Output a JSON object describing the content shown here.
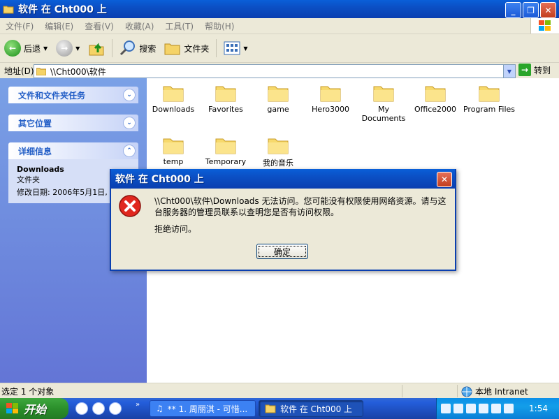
{
  "window": {
    "title": "软件 在 Cht000 上"
  },
  "menu": [
    "文件(F)",
    "编辑(E)",
    "查看(V)",
    "收藏(A)",
    "工具(T)",
    "帮助(H)"
  ],
  "toolbar": {
    "back_label": "后退",
    "search_label": "搜索",
    "folders_label": "文件夹"
  },
  "address": {
    "label": "地址(D)",
    "path": "\\\\Cht000\\软件",
    "go_label": "转到"
  },
  "taskpane": {
    "file_tasks": "文件和文件夹任务",
    "other_places": "其它位置",
    "details": {
      "title": "详细信息",
      "name": "Downloads",
      "type": "文件夹",
      "modified": "修改日期: 2006年5月1日,"
    }
  },
  "files": [
    "Downloads",
    "Favorites",
    "game",
    "Hero3000",
    "My Documents",
    "Office2000",
    "Program Files",
    "temp",
    "Temporary",
    "我的音乐"
  ],
  "dialog": {
    "title": "软件 在 Cht000 上",
    "message": "\\\\Cht000\\软件\\Downloads 无法访问。您可能没有权限使用网络资源。请与这台服务器的管理员联系以查明您是否有访问权限。",
    "message2": "拒绝访问。",
    "ok_label": "确定"
  },
  "statusbar": {
    "left": "选定 1 个对象",
    "zone": "本地 Intranet"
  },
  "taskbar": {
    "start": "开始",
    "tasks": [
      "** 1. 周丽淇 - 可惜...",
      "软件 在 Cht000 上"
    ],
    "clock": "1:54"
  }
}
